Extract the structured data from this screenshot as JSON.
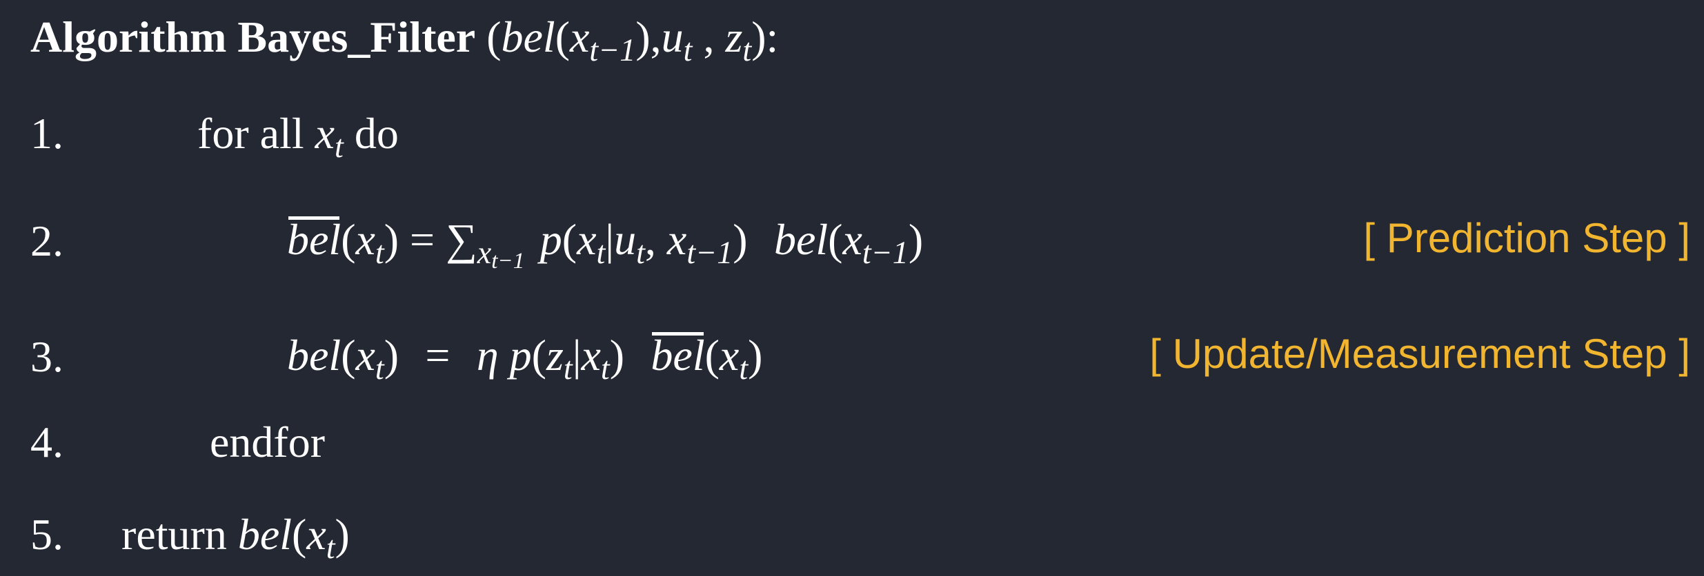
{
  "header": {
    "algorithm_keyword": "Algorithm",
    "algorithm_name": "Bayes_Filter",
    "signature": "(bel(xt−1), ut , zt):"
  },
  "lines": [
    {
      "number": "1.",
      "text": "for all xt do"
    },
    {
      "number": "2.",
      "text": "bel(xt) = ∑xt−1 p(xt|ut, xt−1) bel(xt−1)",
      "tag": "[ Prediction Step ]"
    },
    {
      "number": "3.",
      "text": "bel(xt) = η p(zt|xt) bel(xt)",
      "tag": "[ Update/Measurement Step ]"
    },
    {
      "number": "4.",
      "text": "endfor"
    },
    {
      "number": "5.",
      "text": "return bel(xt)"
    }
  ],
  "colors": {
    "background": "#242833",
    "text": "#ffffff",
    "annotation": "#f1b52f"
  }
}
